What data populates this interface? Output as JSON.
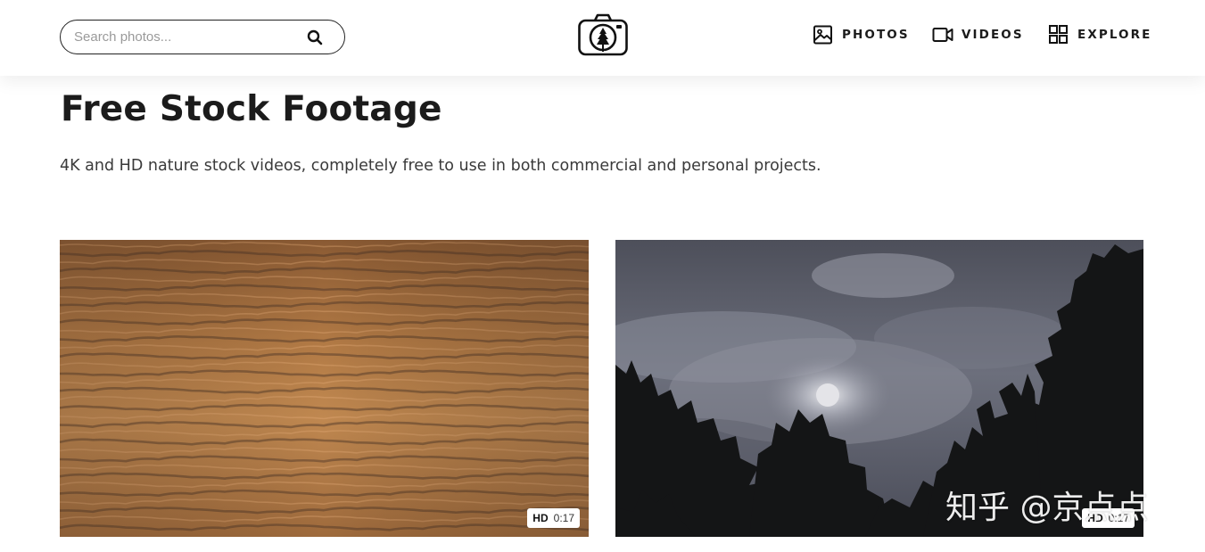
{
  "header": {
    "search": {
      "placeholder": "Search photos...",
      "value": ""
    },
    "logo_icon": "camera-tree-icon",
    "nav": [
      {
        "label": "PHOTOS",
        "icon": "image-icon"
      },
      {
        "label": "VIDEOS",
        "icon": "video-camera-icon"
      },
      {
        "label": "EXPLORE",
        "icon": "grid-icon"
      }
    ]
  },
  "main": {
    "title": "Free Stock Footage",
    "subtitle": "4K and HD nature stock videos, completely free to use in both commercial and personal projects.",
    "videos": [
      {
        "quality": "HD",
        "duration": "0:17"
      },
      {
        "quality": "HD",
        "duration": "0:17"
      }
    ]
  },
  "watermark": {
    "text": "知乎 @京点点"
  },
  "colors": {
    "text": "#1b1b1b",
    "background": "#ffffff",
    "subtitle": "#3a3a3a"
  }
}
